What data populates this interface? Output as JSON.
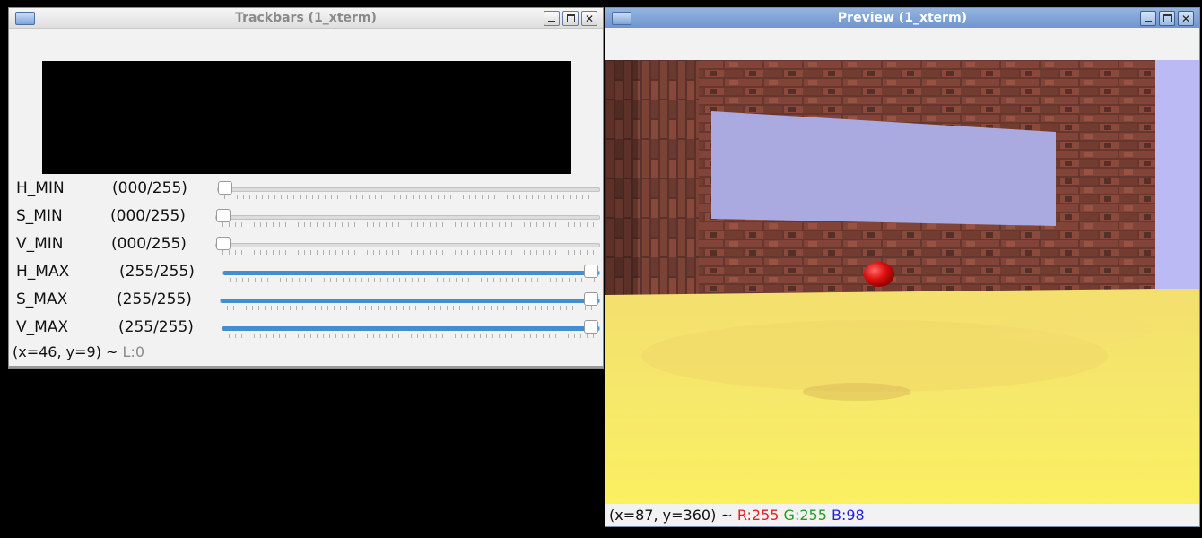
{
  "trackbars_window": {
    "title": "Trackbars (1_xterm)",
    "sliders": [
      {
        "name": "H_MIN",
        "range_text": "(000/255)",
        "value": 0,
        "max": 255
      },
      {
        "name": "S_MIN",
        "range_text": "(000/255)",
        "value": 0,
        "max": 255
      },
      {
        "name": "V_MIN",
        "range_text": "(000/255)",
        "value": 0,
        "max": 255
      },
      {
        "name": "H_MAX",
        "range_text": "(255/255)",
        "value": 255,
        "max": 255
      },
      {
        "name": "S_MAX",
        "range_text": "(255/255)",
        "value": 255,
        "max": 255
      },
      {
        "name": "V_MAX",
        "range_text": "(255/255)",
        "value": 255,
        "max": 255
      }
    ],
    "status": {
      "coords": "(x=46, y=9) ~",
      "level": "L:0"
    }
  },
  "preview_window": {
    "title": "Preview (1_xterm)",
    "status": {
      "coords": "(x=87, y=360) ~",
      "r": "R:255",
      "g": "G:255",
      "b": "B:98"
    }
  },
  "colors": {
    "active_title": "#7a9ed4",
    "slider_fill": "#3f8fd2",
    "status_r": "#e52222",
    "status_g": "#23a021",
    "status_b": "#2222e5"
  }
}
